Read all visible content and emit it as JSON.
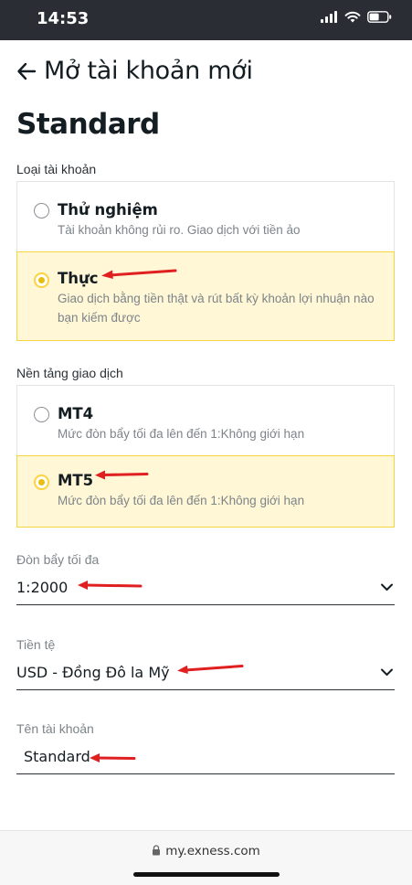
{
  "status_bar": {
    "time": "14:53",
    "icons": [
      "signal-icon",
      "wifi-icon",
      "battery-icon"
    ]
  },
  "header": {
    "back_icon": "arrow-left-icon",
    "title": "Mở tài khoản mới"
  },
  "page_title": "Standard",
  "account_type": {
    "label": "Loại tài khoản",
    "options": [
      {
        "title": "Thử nghiệm",
        "description": "Tài khoản không rủi ro. Giao dịch với tiền ảo",
        "selected": false
      },
      {
        "title": "Thực",
        "description": "Giao dịch bằng tiền thật và rút bất kỳ khoản lợi nhuận nào bạn kiếm được",
        "selected": true
      }
    ]
  },
  "platform": {
    "label": "Nền tảng giao dịch",
    "options": [
      {
        "title": "MT4",
        "description": "Mức đòn bẩy tối đa lên đến 1:Không giới hạn",
        "selected": false
      },
      {
        "title": "MT5",
        "description": "Mức đòn bẩy tối đa lên đến 1:Không giới hạn",
        "selected": true
      }
    ]
  },
  "leverage": {
    "label": "Đòn bẩy tối đa",
    "value": "1:2000"
  },
  "currency": {
    "label": "Tiền tệ",
    "value": "USD - Đồng Đô la Mỹ"
  },
  "account_name": {
    "label": "Tên tài khoản",
    "value": "Standard"
  },
  "browser": {
    "url": "my.exness.com"
  },
  "colors": {
    "selected_bg": "#fff7d6",
    "selected_border": "#f2d63f",
    "radio_accent": "#e8be10",
    "annotation_arrow": "#e02020"
  }
}
